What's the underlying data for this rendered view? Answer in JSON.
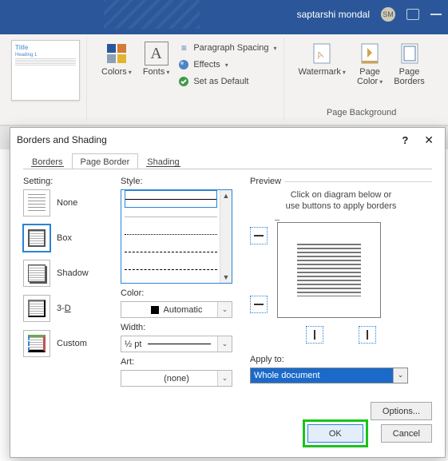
{
  "titlebar": {
    "username": "saptarshi mondal",
    "initials": "SM"
  },
  "ribbon": {
    "thumb": {
      "title": "Title",
      "heading": "Heading 1"
    },
    "colors_label": "Colors",
    "fonts_label": "Fonts",
    "para_spacing": "Paragraph Spacing",
    "effects": "Effects",
    "set_default": "Set as Default",
    "watermark": "Watermark",
    "page_color": "Page\nColor",
    "page_borders": "Page\nBorders",
    "group_bg": "Page Background"
  },
  "dialog": {
    "title": "Borders and Shading",
    "tabs": {
      "borders": "Borders",
      "page_border": "Page Border",
      "shading": "Shading"
    },
    "setting_label": "Setting:",
    "settings": {
      "none": "None",
      "box": "Box",
      "shadow": "Shadow",
      "three_d": "3-D",
      "custom": "Custom"
    },
    "style_label": "Style:",
    "color_label": "Color:",
    "color_value": "Automatic",
    "width_label": "Width:",
    "width_value": "½ pt",
    "art_label": "Art:",
    "art_value": "(none)",
    "preview_label": "Preview",
    "preview_hint1": "Click on diagram below or",
    "preview_hint2": "use buttons to apply borders",
    "apply_label": "Apply to:",
    "apply_value": "Whole document",
    "options": "Options...",
    "ok": "OK",
    "cancel": "Cancel"
  }
}
